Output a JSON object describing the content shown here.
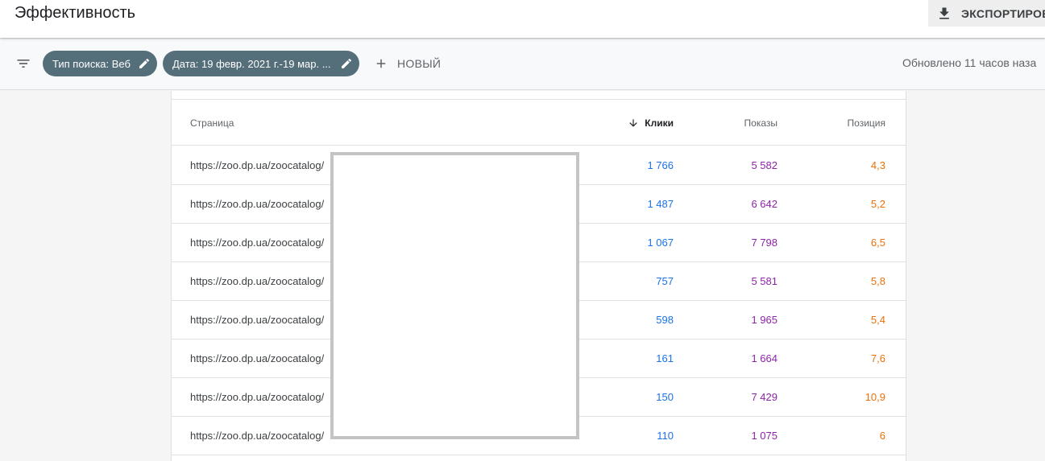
{
  "header": {
    "title": "Эффективность",
    "export_label": "ЭКСПОРТИРОВ"
  },
  "filters": {
    "chips": [
      {
        "label": "Тип поиска: Веб"
      },
      {
        "label": "Дата: 19 февр. 2021 г.-19 мар. ..."
      }
    ],
    "new_label": "НОВЫЙ",
    "updated_text": "Обновлено 11 часов наза"
  },
  "table": {
    "columns": {
      "page": "Страница",
      "clicks": "Клики",
      "impressions": "Показы",
      "position": "Позиция"
    },
    "rows": [
      {
        "url": "https://zoo.dp.ua/zoocatalog/",
        "clicks": "1 766",
        "impressions": "5 582",
        "position": "4,3"
      },
      {
        "url": "https://zoo.dp.ua/zoocatalog/",
        "clicks": "1 487",
        "impressions": "6 642",
        "position": "5,2"
      },
      {
        "url": "https://zoo.dp.ua/zoocatalog/",
        "clicks": "1 067",
        "impressions": "7 798",
        "position": "6,5"
      },
      {
        "url": "https://zoo.dp.ua/zoocatalog/",
        "clicks": "757",
        "impressions": "5 581",
        "position": "5,8"
      },
      {
        "url": "https://zoo.dp.ua/zoocatalog/",
        "clicks": "598",
        "impressions": "1 965",
        "position": "5,4"
      },
      {
        "url": "https://zoo.dp.ua/zoocatalog/",
        "clicks": "161",
        "impressions": "1 664",
        "position": "7,6"
      },
      {
        "url": "https://zoo.dp.ua/zoocatalog/",
        "clicks": "150",
        "impressions": "7 429",
        "position": "10,9"
      },
      {
        "url": "https://zoo.dp.ua/zoocatalog/",
        "clicks": "110",
        "impressions": "1 075",
        "position": "6"
      }
    ]
  },
  "icons": {
    "export": "download-icon",
    "filter": "filter-list-icon",
    "edit": "pencil-icon",
    "add": "plus-icon",
    "sort": "arrow-down-icon"
  },
  "colors": {
    "chip_bg": "#546e7a",
    "clicks": "#1a73e8",
    "impressions": "#8e24aa",
    "position": "#e8710a"
  }
}
